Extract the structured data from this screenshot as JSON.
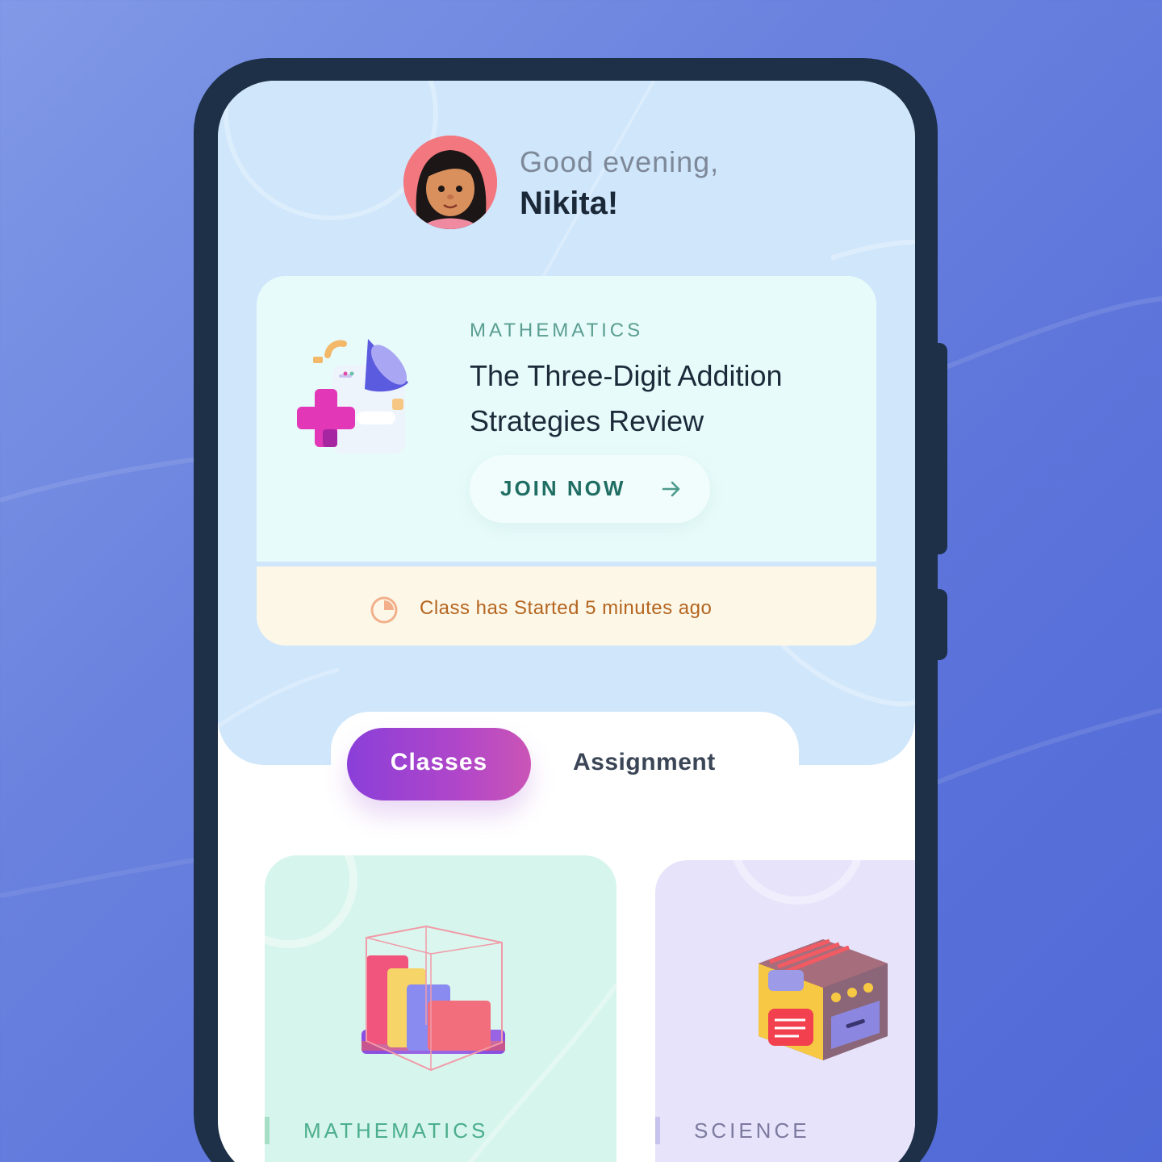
{
  "greeting": {
    "salutation": "Good evening,",
    "name": "Nikita!"
  },
  "live_class": {
    "subject": "MATHEMATICS",
    "title": "The Three-Digit Addition Strategies Review",
    "join_label": "JOIN NOW",
    "status": "Class has Started 5 minutes ago",
    "icons": [
      "math-3d-illustration",
      "arrow-right-icon",
      "clock-icon"
    ]
  },
  "tabs": [
    {
      "label": "Classes",
      "active": true
    },
    {
      "label": "Assignment",
      "active": false
    }
  ],
  "subjects": [
    {
      "label": "MATHEMATICS",
      "color": "#4cae8c"
    },
    {
      "label": "SCIENCE",
      "color": "#7d7aa0"
    }
  ],
  "colors": {
    "background": "#6b83de",
    "phone_frame": "#1d3048",
    "header": "#cfe6fb",
    "card": "#e7fbfa",
    "status_banner": "#fdf7e8",
    "active_tab_start": "#8a3fd9",
    "active_tab_end": "#cb55b6"
  }
}
